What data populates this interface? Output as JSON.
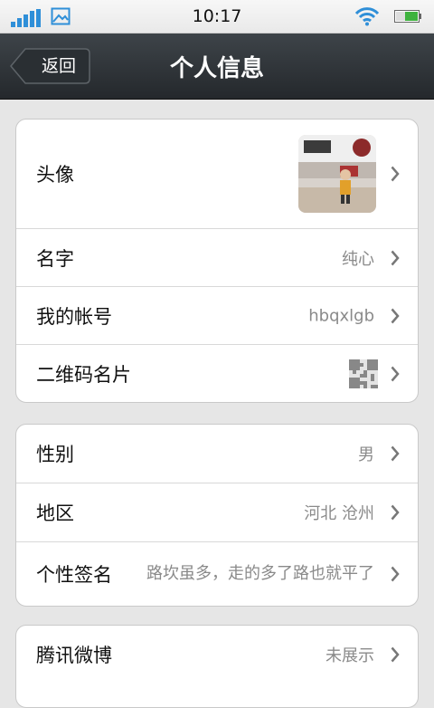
{
  "status_bar": {
    "time": "10:17"
  },
  "nav": {
    "back_label": "返回",
    "title": "个人信息"
  },
  "group1": {
    "avatar": {
      "label": "头像"
    },
    "name": {
      "label": "名字",
      "value": "纯心"
    },
    "account": {
      "label": "我的帐号",
      "value": "hbqxlgb"
    },
    "qrcode": {
      "label": "二维码名片"
    }
  },
  "group2": {
    "gender": {
      "label": "性别",
      "value": "男"
    },
    "region": {
      "label": "地区",
      "value": "河北 沧州"
    },
    "signature": {
      "label": "个性签名",
      "value": "路坎虽多，走的多了路也就平了"
    }
  },
  "group3": {
    "weibo": {
      "label": "腾讯微博",
      "value": "未展示"
    }
  },
  "colors": {
    "signal_blue": "#2f8fd8",
    "battery_green": "#3fb23f",
    "nav_dark": "#2d3236",
    "value_gray": "#8a8a8a"
  },
  "icons": [
    "signal-icon",
    "picture-icon",
    "wifi-icon",
    "battery-icon",
    "chevron-right-icon",
    "qr-code-icon"
  ]
}
